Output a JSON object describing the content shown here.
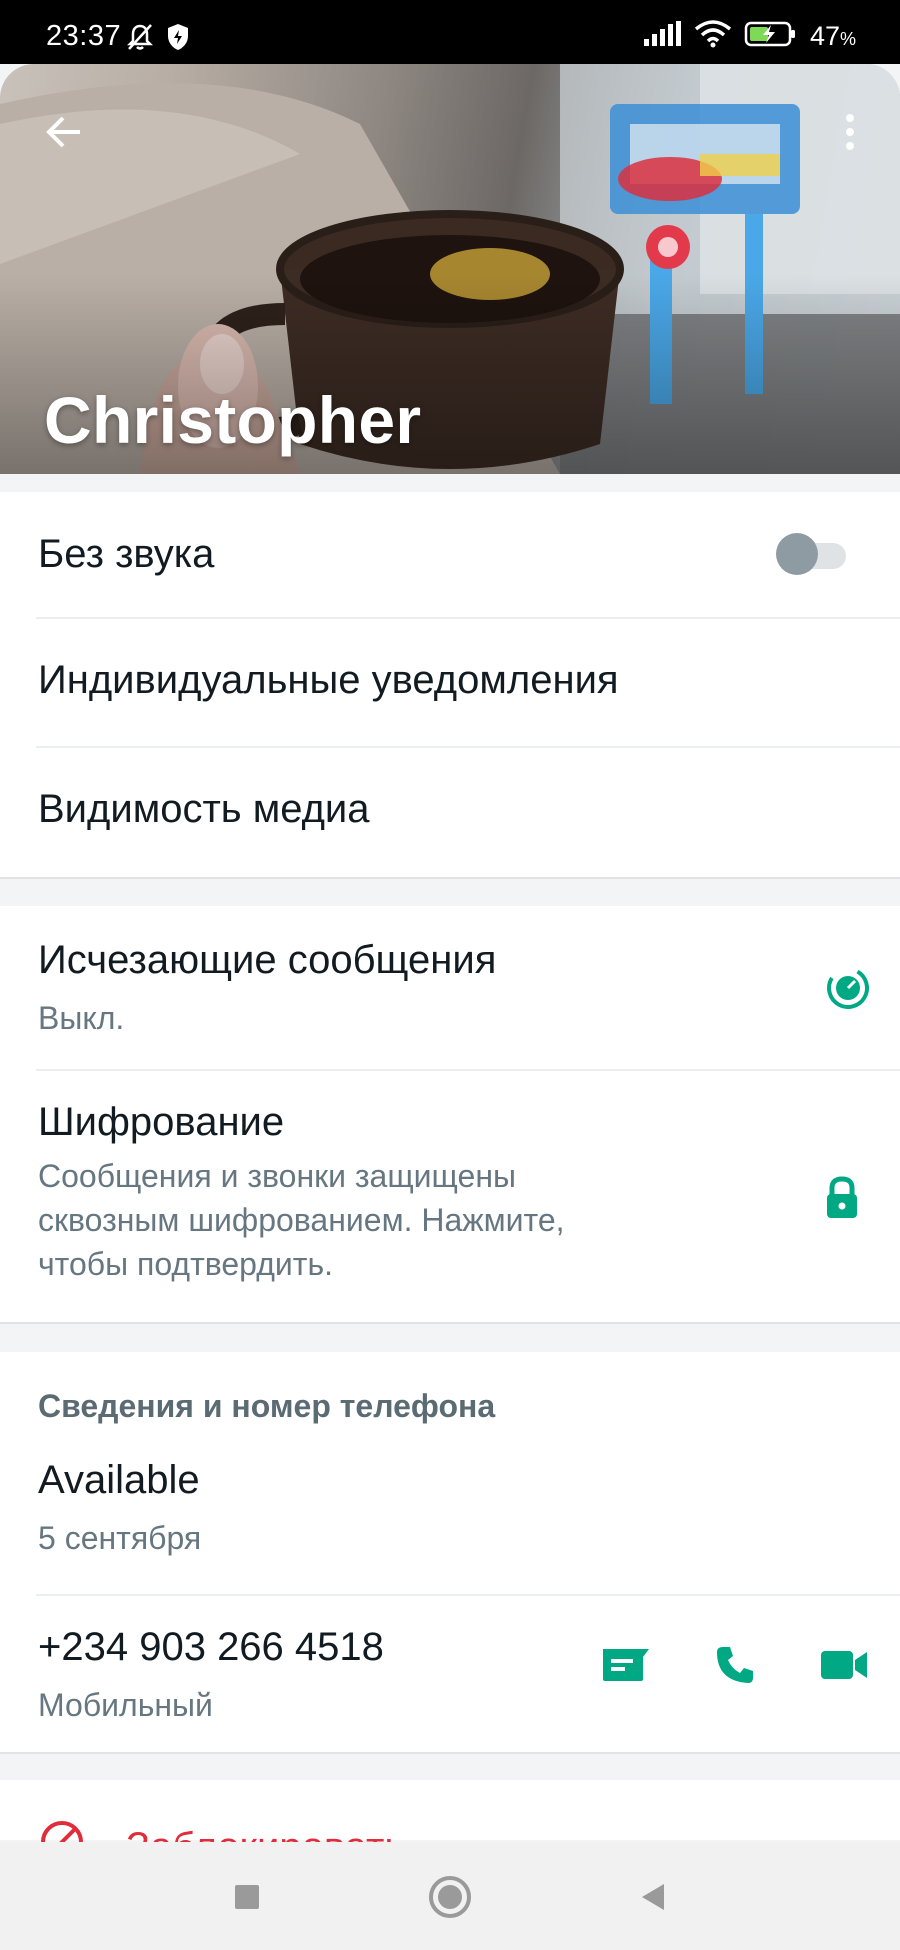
{
  "status_bar": {
    "time": "23:37",
    "battery_percent": "47",
    "battery_unit": "%",
    "icons": [
      "muted-bell-icon",
      "shield-icon",
      "signal-icon",
      "wifi-icon",
      "battery-charging-icon"
    ]
  },
  "header": {
    "contact_name": "Christopher",
    "back_icon": "arrow-left-icon",
    "menu_icon": "more-vert-icon"
  },
  "notifications": {
    "mute_label": "Без звука",
    "mute_enabled": false,
    "custom_notifications_label": "Индивидуальные уведомления",
    "media_visibility_label": "Видимость медиа"
  },
  "privacy": {
    "disappearing_title": "Исчезающие сообщения",
    "disappearing_status": "Выкл.",
    "encryption_title": "Шифрование",
    "encryption_line1": "Сообщения и звонки защищены",
    "encryption_line2": "сквозным шифрованием. Нажмите,",
    "encryption_line3": "чтобы подтвердить."
  },
  "about": {
    "section_title": "Сведения и номер телефона",
    "about_text": "Available",
    "about_date": "5 сентября",
    "phone": "+234 903 266 4518",
    "phone_type": "Мобильный"
  },
  "actions": {
    "block_label": "Заблокировать"
  },
  "colors": {
    "accent_green": "#00a884",
    "danger_red": "#e02d3c",
    "secondary_text": "#667781"
  }
}
